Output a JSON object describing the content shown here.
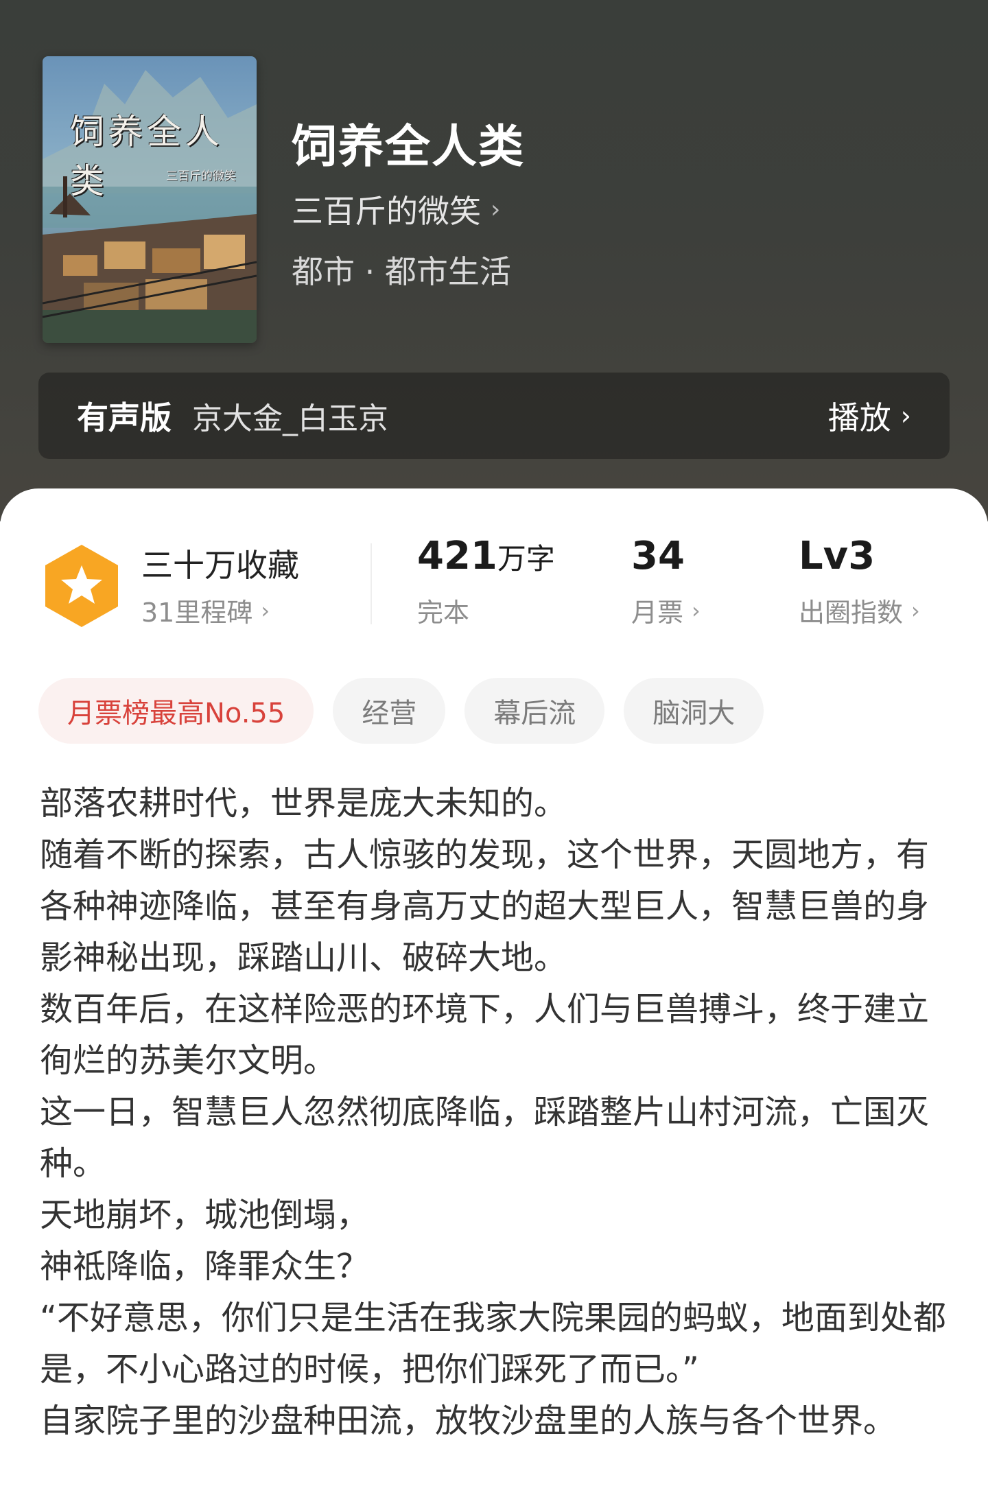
{
  "book": {
    "cover_title": "饲养全人类",
    "cover_author": "三百斤的微笑",
    "title": "饲养全人类",
    "author": "三百斤的微笑",
    "genre": "都市 · 都市生活"
  },
  "audio": {
    "label": "有声版",
    "narrator": "京大金_白玉京",
    "play_label": "播放"
  },
  "stats": {
    "favorites": "三十万收藏",
    "milestones": "31里程碑",
    "word_count": "421",
    "word_unit": "万字",
    "status": "完本",
    "monthly_votes": "34",
    "monthly_votes_label": "月票",
    "level": "Lv3",
    "level_label": "出圈指数"
  },
  "tags": [
    "月票榜最高No.55",
    "经营",
    "幕后流",
    "脑洞大"
  ],
  "description": [
    "部落农耕时代，世界是庞大未知的。",
    "随着不断的探索，古人惊骇的发现，这个世界，天圆地方，有各种神迹降临，甚至有身高万丈的超大型巨人，智慧巨兽的身影神秘出现，踩踏山川、破碎大地。",
    "数百年后，在这样险恶的环境下，人们与巨兽搏斗，终于建立徇烂的苏美尔文明。",
    "这一日，智慧巨人忽然彻底降临，踩踏整片山村河流，亡国灭种。",
    "天地崩坏，城池倒塌，",
    "神祗降临，降罪众生？",
    "“不好意思，你们只是生活在我家大院果园的蚂蚁，地面到处都是，不小心路过的时候，把你们踩死了而已。”",
    "自家院子里的沙盘种田流，放牧沙盘里的人族与各个世界。"
  ],
  "colors": {
    "header_bg": "#3d3f3b",
    "badge": "#f8a623",
    "hot_tag_text": "#d8423b"
  },
  "icons": [
    "book-cover",
    "chevron-right-icon",
    "star-badge-icon"
  ]
}
